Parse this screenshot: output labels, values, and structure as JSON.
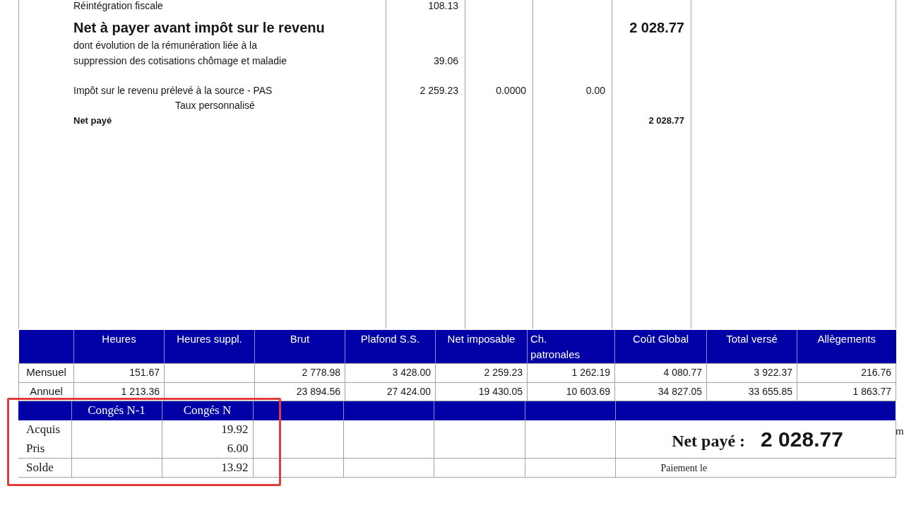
{
  "earnings_lines": [
    {
      "kind": "detail",
      "label": "Réintégration fiscale",
      "column_2": "108.13"
    },
    {
      "kind": "headline",
      "label": "Net à payer avant impôt sur le revenu",
      "column_5": "2 028.77"
    },
    {
      "kind": "detail",
      "label": "dont évolution de la rémunération liée à la"
    },
    {
      "kind": "detail",
      "label": "suppression des cotisations chômage et maladie",
      "column_2": "39.06"
    },
    {
      "kind": "tax",
      "label": "Impôt sur le revenu prélevé à la source - PAS",
      "column_2": "2 259.23",
      "column_3": "0.0000",
      "column_4": "0.00"
    },
    {
      "kind": "note",
      "label": "Taux personnalisé"
    },
    {
      "kind": "total",
      "label": "Net payé",
      "column_5": "2 028.77"
    }
  ],
  "totals_table": {
    "columns": [
      {
        "label": "Heures",
        "kind": "centered"
      },
      {
        "label": "Heures suppl.",
        "kind": "centered"
      },
      {
        "label": "Brut",
        "kind": "centered"
      },
      {
        "label": "Plafond S.S.",
        "kind": "centered"
      },
      {
        "label": "Net imposable",
        "kind": "centered"
      },
      {
        "label": "Ch. patronales",
        "kind": "wrapped"
      },
      {
        "label": "Coût Global",
        "kind": "centered"
      },
      {
        "label": "Total versé",
        "kind": "centered"
      },
      {
        "label": "Allègements",
        "kind": "centered"
      }
    ],
    "rows": [
      {
        "label": "Mensuel",
        "heures": "151.67",
        "brut": "2 778.98",
        "plafond_ss": "3 428.00",
        "net_imposable": "2 259.23",
        "ch_patronales": "1 262.19",
        "cout_global": "4 080.77",
        "total_verse": "3 922.37",
        "allegements": "216.76"
      },
      {
        "label": "Annuel",
        "heures": "1 213.36",
        "brut": "23 894.56",
        "plafond_ss": "27 424.00",
        "net_imposable": "19 430.05",
        "ch_patronales": "10 603.69",
        "cout_global": "34 827.05",
        "total_verse": "33 655.85",
        "allegements": "1 863.77"
      }
    ]
  },
  "leave_table": {
    "columns": [
      "Congés N-1",
      "Congés N"
    ],
    "rows": [
      {
        "label": "Acquis",
        "conges_n": "19.92"
      },
      {
        "label": "Pris",
        "conges_n": "6.00"
      },
      {
        "label": "Solde",
        "conges_n": "13.92"
      }
    ]
  },
  "net_pay": {
    "label": "Net payé :",
    "amount": "2 028.77",
    "payment_label": "Paiement le"
  },
  "margin_fragment": "m"
}
